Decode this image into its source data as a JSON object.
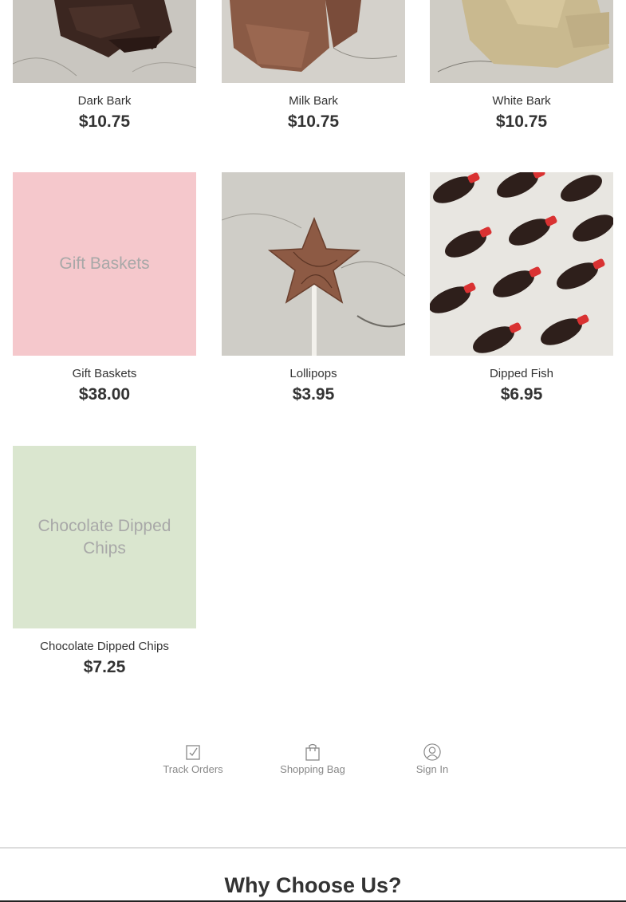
{
  "products": [
    {
      "name": "Dark Bark",
      "price": "$10.75"
    },
    {
      "name": "Milk Bark",
      "price": "$10.75"
    },
    {
      "name": "White Bark",
      "price": "$10.75"
    },
    {
      "name": "Gift Baskets",
      "price": "$38.00",
      "placeholder": "Gift Baskets"
    },
    {
      "name": "Lollipops",
      "price": "$3.95"
    },
    {
      "name": "Dipped Fish",
      "price": "$6.95"
    },
    {
      "name": "Chocolate Dipped Chips",
      "price": "$7.25",
      "placeholder": "Chocolate Dipped Chips"
    }
  ],
  "colors": {
    "gift_baskets_tile": "#f5c8cc",
    "chips_tile": "#dae6cf",
    "candy_red": "#d93232",
    "dark_chocolate": "#2e1f1b"
  },
  "footer_nav": {
    "track_orders": "Track Orders",
    "shopping_bag": "Shopping Bag",
    "sign_in": "Sign In"
  },
  "why": {
    "title": "Why Choose Us?"
  }
}
